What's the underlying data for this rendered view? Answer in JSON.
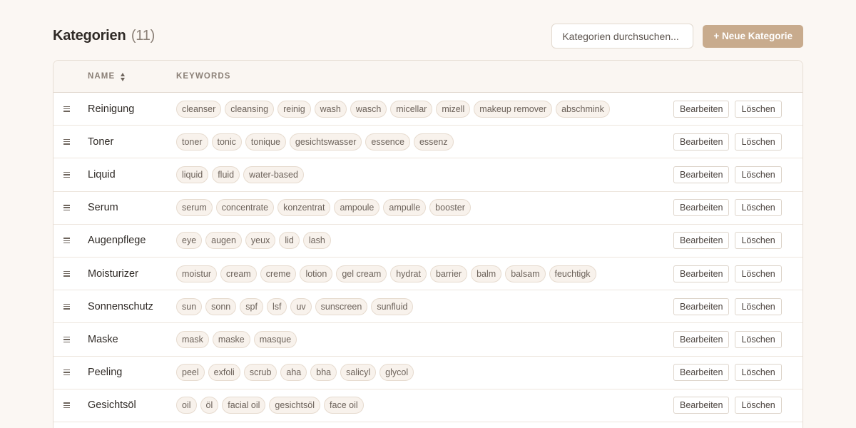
{
  "header": {
    "title": "Kategorien",
    "count": "(11)",
    "search_placeholder": "Kategorien durchsuchen...",
    "new_button_label": "+ Neue Kategorie"
  },
  "table": {
    "columns": {
      "name": "NAME",
      "keywords": "KEYWORDS"
    },
    "edit_label": "Bearbeiten",
    "delete_label": "Löschen",
    "rows": [
      {
        "name": "Reinigung",
        "keywords": [
          "cleanser",
          "cleansing",
          "reinig",
          "wash",
          "wasch",
          "micellar",
          "mizell",
          "makeup remover",
          "abschmink"
        ]
      },
      {
        "name": "Toner",
        "keywords": [
          "toner",
          "tonic",
          "tonique",
          "gesichtswasser",
          "essence",
          "essenz"
        ]
      },
      {
        "name": "Liquid",
        "keywords": [
          "liquid",
          "fluid",
          "water-based"
        ]
      },
      {
        "name": "Serum",
        "keywords": [
          "serum",
          "concentrate",
          "konzentrat",
          "ampoule",
          "ampulle",
          "booster"
        ]
      },
      {
        "name": "Augenpflege",
        "keywords": [
          "eye",
          "augen",
          "yeux",
          "lid",
          "lash"
        ]
      },
      {
        "name": "Moisturizer",
        "keywords": [
          "moistur",
          "cream",
          "creme",
          "lotion",
          "gel cream",
          "hydrat",
          "barrier",
          "balm",
          "balsam",
          "feuchtigk"
        ]
      },
      {
        "name": "Sonnenschutz",
        "keywords": [
          "sun",
          "sonn",
          "spf",
          "lsf",
          "uv",
          "sunscreen",
          "sunfluid"
        ]
      },
      {
        "name": "Maske",
        "keywords": [
          "mask",
          "maske",
          "masque"
        ]
      },
      {
        "name": "Peeling",
        "keywords": [
          "peel",
          "exfoli",
          "scrub",
          "aha",
          "bha",
          "salicyl",
          "glycol"
        ]
      },
      {
        "name": "Gesichtsöl",
        "keywords": [
          "oil",
          "öl",
          "facial oil",
          "gesichtsöl",
          "face oil"
        ]
      }
    ]
  },
  "colors": {
    "accent": "#c8ab8d",
    "background": "#fbf7f3",
    "tag_background": "#f8f2ec",
    "tag_border": "#e6dbcf"
  },
  "icons": {
    "drag_handle": "drag-handle-icon",
    "sort": "sort-icon"
  }
}
